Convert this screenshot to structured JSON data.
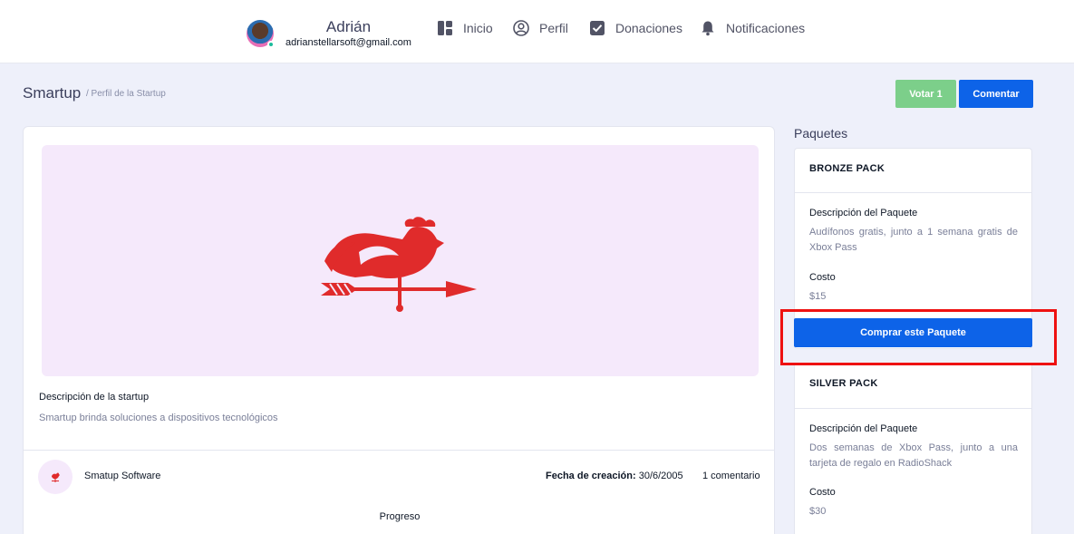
{
  "user": {
    "name": "Adrián",
    "email": "adrianstellarsoft@gmail.com"
  },
  "nav": {
    "items": [
      {
        "label": "Inicio",
        "icon": "dashboard-icon"
      },
      {
        "label": "Perfil",
        "icon": "user-circle-icon"
      },
      {
        "label": "Donaciones",
        "icon": "check-square-icon"
      },
      {
        "label": "Notificaciones",
        "icon": "bell-icon"
      }
    ]
  },
  "header": {
    "title": "Smartup",
    "breadcrumb": "/ Perfil de la Startup",
    "vote_label": "Votar 1",
    "comment_label": "Comentar"
  },
  "startup": {
    "description_label": "Descripción de la startup",
    "description": "Smartup brinda soluciones a dispositivos tecnológicos",
    "company": "Smatup Software",
    "created_label": "Fecha de creación:",
    "created_value": "30/6/2005",
    "comments": "1 comentario",
    "progress_label": "Progreso"
  },
  "packages": {
    "title": "Paquetes",
    "items": [
      {
        "name": "BRONZE PACK",
        "description_label": "Descripción del Paquete",
        "description": "Audífonos gratis, junto a 1 semana gratis de Xbox Pass",
        "cost_label": "Costo",
        "cost": "$15",
        "buy_label": "Comprar este Paquete"
      },
      {
        "name": "SILVER PACK",
        "description_label": "Descripción del Paquete",
        "description": "Dos semanas de Xbox Pass, junto a una tarjeta de regalo en RadioShack",
        "cost_label": "Costo",
        "cost": "$30"
      }
    ]
  },
  "colors": {
    "primary": "#0d63e8",
    "success": "#7ccf8a",
    "highlight": "#ee1111",
    "logo": "#e02b2b",
    "hero_bg": "#f5e9fb"
  }
}
